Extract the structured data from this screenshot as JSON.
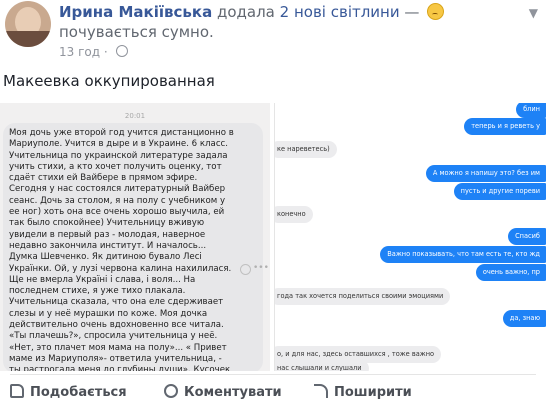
{
  "post": {
    "author": "Ирина Макіївська",
    "action_pre": "додала",
    "action_link": "2 нові світлини",
    "dash": "—",
    "feeling_text": "почувається сумно.",
    "time": "13 год",
    "caption": "Макеевка оккупированная"
  },
  "left_screenshot": {
    "time": "20:01",
    "message": "Моя дочь уже второй год учится дистанционно в Мариуполе. Учится в дыре и в Украине. 6 класс. Учительница по украинской литературе задала учить стихи, а кто хочет получить оценку, тот сдаёт стихи ей Вайбере в прямом эфире. Сегодня у нас состоялся литературный Вайбер сеанс. Дочь за столом, я на полу с учебником у ее ног) хоть она все очень хорошо выучила, ей так было спокойнее) Учительницу вживую увидели в первый раз - молодая, наверное недавно закончила институт. И началось... Думка Шевченко. Як дитиною бувало Лесі Українки. Ой, у лузі червона калина нахилилася. Ще не вмерла Україні і слава, і воля... На последнем стихе, я уже тихо плакала. Учительница сказала, что она еле сдерживает слезы и у неё мурашки по коже. Моя дочка действительно очень вдохновенно все читала. «Ты плачешь?», спросила учительница у неё. «Нет, это плачет моя мама на полу»... « Привет маме из Мариуполя»- ответила учительница, - ты растрогала меня до глубины души». Кусочек Украины в отдельно взятой квартире оккупированного Донбасса. Вайбер."
  },
  "right_screenshot": {
    "bubbles": [
      {
        "side": "me",
        "text": "блин"
      },
      {
        "side": "me",
        "text": "теперь и я реветь у"
      },
      {
        "side": "them",
        "text": "ке нареветесь)"
      },
      {
        "side": "me",
        "text": "А можно я напишу это? без им"
      },
      {
        "side": "me",
        "text": "пусть и другие пореви"
      },
      {
        "side": "them",
        "text": "конечно"
      },
      {
        "side": "me",
        "text": "Спасиб"
      },
      {
        "side": "me",
        "text": "Важно показывать, что там есть те, кто жд"
      },
      {
        "side": "me",
        "text": "очень важно, пр"
      },
      {
        "side": "them",
        "text": "года так хочется поделиться своими эмоциями"
      },
      {
        "side": "me",
        "text": "да, знаю"
      },
      {
        "side": "them",
        "text": "о, и для нас, здесь оставшихся , тоже важно"
      },
      {
        "side": "them",
        "text": "нас слышали и слушали"
      }
    ]
  },
  "actions": {
    "like": "Подобається",
    "comment": "Коментувати",
    "share": "Поширити"
  }
}
